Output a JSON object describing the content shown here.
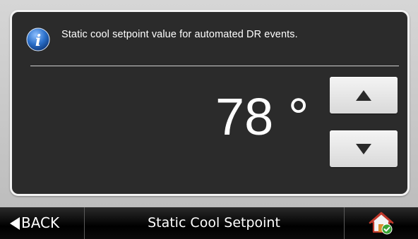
{
  "info": {
    "icon": "info-icon",
    "text": "Static cool setpoint value for automated DR events."
  },
  "setpoint": {
    "value_display": "78 °",
    "up_icon": "arrow-up-icon",
    "down_icon": "arrow-down-icon"
  },
  "bottom_bar": {
    "back_label": "BACK",
    "title": "Static Cool Setpoint",
    "home_icon": "home-check-icon"
  },
  "colors": {
    "panel_bg": "#2b2b2b",
    "panel_border": "#f2f2f2",
    "button_bg": "#e6e6e6",
    "bar_bg": "#000000",
    "info_blue": "#2a6fc9"
  }
}
